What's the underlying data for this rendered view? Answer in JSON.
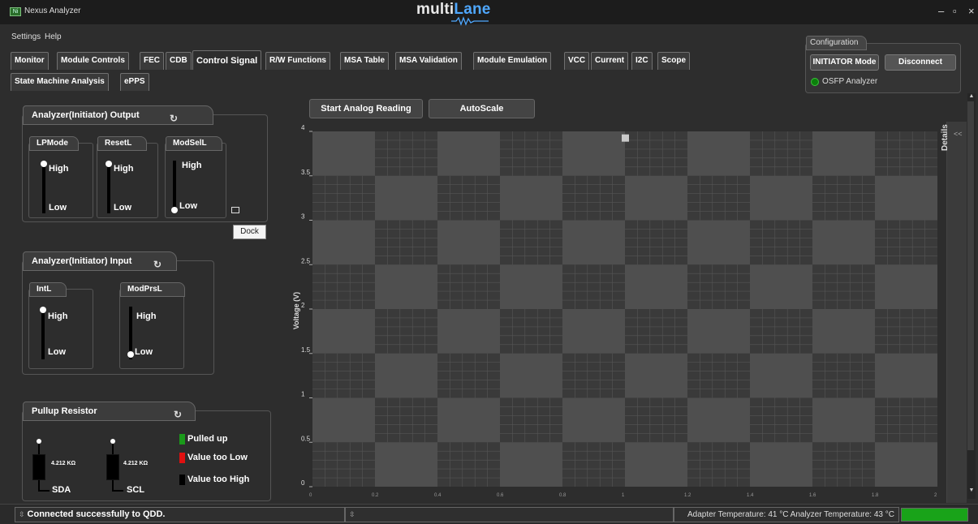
{
  "titlebar": {
    "app_icon_text": "Ni",
    "app_title": "Nexus Analyzer",
    "logo_main": "multi",
    "logo_accent": "Lane",
    "minimize": "–",
    "maximize": "▫",
    "close": "×"
  },
  "menu": {
    "settings": "Settings",
    "help": "Help"
  },
  "tabs_row1": [
    "Monitor",
    "Module Controls",
    "FEC",
    "CDB",
    "Control Signal",
    "R/W Functions",
    "MSA Table",
    "MSA Validation",
    "Module Emulation",
    "VCC",
    "Current",
    "I2C",
    "Scope"
  ],
  "tabs_row2": [
    "State Machine Analysis",
    "ePPS"
  ],
  "active_tab": "Control Signal",
  "configuration": {
    "title": "Configuration",
    "mode_button": "INITIATOR Mode",
    "disconnect_button": "Disconnect",
    "device_label": "OSFP Analyzer",
    "device_status_color": "#0b7f0b"
  },
  "output_group": {
    "title": "Analyzer(Initiator) Output",
    "signals": [
      {
        "name": "LPMode",
        "high": "High",
        "low": "Low",
        "state": "High"
      },
      {
        "name": "ResetL",
        "high": "High",
        "low": "Low",
        "state": "High"
      },
      {
        "name": "ModSelL",
        "high": "High",
        "low": "Low",
        "state": "Low"
      }
    ],
    "dock_tooltip": "Dock"
  },
  "input_group": {
    "title": "Analyzer(Initiator) Input",
    "signals": [
      {
        "name": "IntL",
        "high": "High",
        "low": "Low",
        "state": "High"
      },
      {
        "name": "ModPrsL",
        "high": "High",
        "low": "Low",
        "state": "Low"
      }
    ]
  },
  "pullup_group": {
    "title": "Pullup Resistor",
    "resistors": [
      {
        "name": "SDA",
        "value": "4.212 KΩ"
      },
      {
        "name": "SCL",
        "value": "4.212 KΩ"
      }
    ],
    "legend": [
      {
        "label": "Pulled up",
        "color": "#1a9a1a"
      },
      {
        "label": "Value too Low",
        "color": "#e01010"
      },
      {
        "label": "Value too High",
        "color": "#000000"
      }
    ]
  },
  "toolbar": {
    "start_analog": "Start Analog Reading",
    "autoscale": "AutoScale"
  },
  "details_label": "Details",
  "details_chevron": "<<",
  "chart_data": {
    "type": "scatter",
    "ylabel": "Voltage (V)",
    "xlabel": "",
    "xlim": [
      0,
      2
    ],
    "ylim": [
      0,
      4
    ],
    "y_ticks": [
      "0",
      "0.5",
      "1",
      "1.5",
      "2",
      "2.5",
      "3",
      "3.5",
      "4"
    ],
    "x_ticks": [
      "0",
      "0.2",
      "0.4",
      "0.6",
      "0.8",
      "1",
      "1.2",
      "1.4",
      "1.6",
      "1.8",
      "2"
    ],
    "series": [
      {
        "x": [
          1.0
        ],
        "y": [
          3.93
        ]
      }
    ],
    "grid": true
  },
  "status": {
    "message": "Connected successfully to QDD.",
    "temperature": "Adapter Temperature: 41 °C  Analyzer Temperature: 43 °C"
  }
}
